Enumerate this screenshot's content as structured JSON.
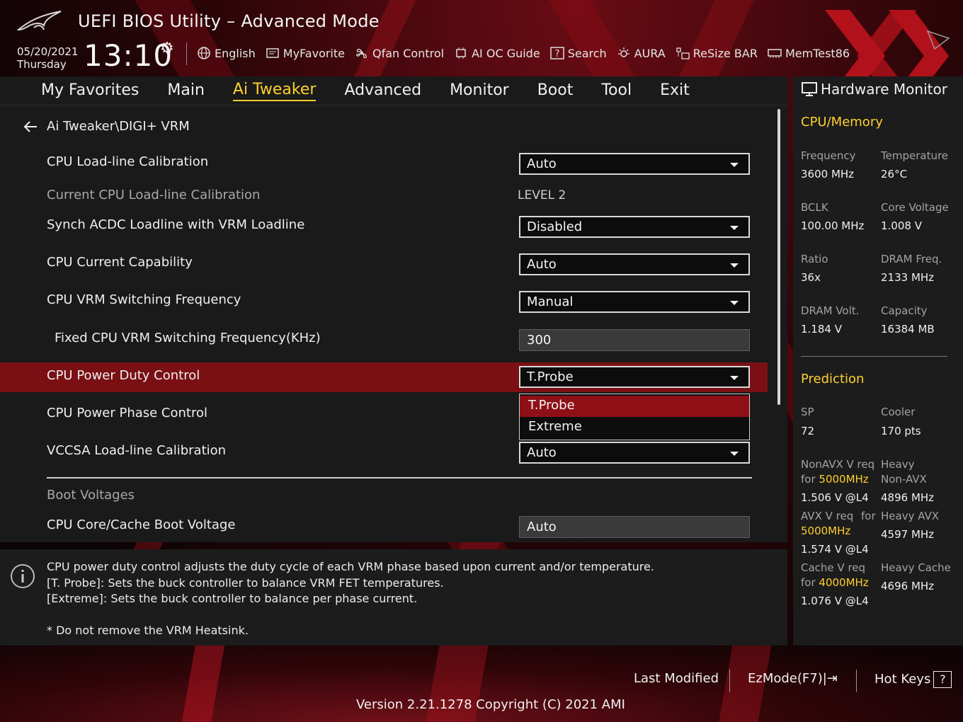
{
  "header": {
    "title": "UEFI BIOS Utility – Advanced Mode",
    "date": "05/20/2021",
    "day": "Thursday",
    "time": "13:10"
  },
  "toolbar": [
    {
      "label": "English",
      "icon": "globe-icon"
    },
    {
      "label": "MyFavorite",
      "icon": "favorite-icon"
    },
    {
      "label": "Qfan Control",
      "icon": "fan-icon"
    },
    {
      "label": "AI OC Guide",
      "icon": "ai-guide-icon"
    },
    {
      "label": "Search",
      "icon": "search-icon"
    },
    {
      "label": "AURA",
      "icon": "aura-icon"
    },
    {
      "label": "ReSize BAR",
      "icon": "resize-bar-icon"
    },
    {
      "label": "MemTest86",
      "icon": "memtest-icon"
    }
  ],
  "menu": {
    "tabs": [
      "My Favorites",
      "Main",
      "Ai Tweaker",
      "Advanced",
      "Monitor",
      "Boot",
      "Tool",
      "Exit"
    ],
    "active": "Ai Tweaker"
  },
  "breadcrumb": "Ai Tweaker\\DIGI+ VRM",
  "settings": {
    "llc": {
      "label": "CPU Load-line Calibration",
      "value": "Auto"
    },
    "current_llc": {
      "label": "Current CPU Load-line Calibration",
      "value": "LEVEL 2"
    },
    "synch": {
      "label": "Synch ACDC Loadline with VRM Loadline",
      "value": "Disabled"
    },
    "current_cap": {
      "label": "CPU Current Capability",
      "value": "Auto"
    },
    "vrm_freq": {
      "label": "CPU VRM Switching Frequency",
      "value": "Manual"
    },
    "fixed_freq": {
      "label": "Fixed CPU VRM Switching Frequency(KHz)",
      "value": "300"
    },
    "duty": {
      "label": "CPU Power Duty Control",
      "value": "T.Probe",
      "options": [
        "T.Probe",
        "Extreme"
      ]
    },
    "phase": {
      "label": "CPU Power Phase Control"
    },
    "vccsa": {
      "label": "VCCSA Load-line Calibration",
      "value": "Auto"
    },
    "boot_section": "Boot Voltages",
    "boot_voltage": {
      "label": "CPU Core/Cache Boot Voltage",
      "value": "Auto"
    }
  },
  "help": {
    "line1": "CPU power duty control adjusts the duty cycle of each VRM phase based upon current and/or temperature.",
    "line2": "[T. Probe]: Sets the buck controller to balance VRM FET temperatures.",
    "line3": "[Extreme]: Sets the buck controller to balance per phase current.",
    "line4": "* Do not remove the VRM Heatsink."
  },
  "hw": {
    "title": "Hardware Monitor",
    "cpu_mem": "CPU/Memory",
    "frequency_k": "Frequency",
    "frequency_v": "3600 MHz",
    "temperature_k": "Temperature",
    "temperature_v": "26°C",
    "bclk_k": "BCLK",
    "bclk_v": "100.00 MHz",
    "corev_k": "Core Voltage",
    "corev_v": "1.008 V",
    "ratio_k": "Ratio",
    "ratio_v": "36x",
    "dramf_k": "DRAM Freq.",
    "dramf_v": "2133 MHz",
    "dramv_k": "DRAM Volt.",
    "dramv_v": "1.184 V",
    "cap_k": "Capacity",
    "cap_v": "16384 MB",
    "prediction": "Prediction",
    "sp_k": "SP",
    "sp_v": "72",
    "cooler_k": "Cooler",
    "cooler_v": "170 pts",
    "nonavx_k1": "NonAVX V req",
    "nonavx_for": "for",
    "nonavx_freq": "5000MHz",
    "nonavx_v": "1.506 V @L4",
    "heavy_k1": "Heavy",
    "heavy_k2": "Non-AVX",
    "heavy_v": "4896 MHz",
    "avx_k1": "AVX V req",
    "avx_for": "for",
    "avx_freq": "5000MHz",
    "avx_v": "1.574 V @L4",
    "heavyavx_k": "Heavy AVX",
    "heavyavx_v": "4597 MHz",
    "cache_k1": "Cache V req",
    "cache_for": "for",
    "cache_freq": "4000MHz",
    "cache_v": "1.076 V @L4",
    "heavycache_k": "Heavy Cache",
    "heavycache_v": "4696 MHz"
  },
  "footer": {
    "last_modified": "Last Modified",
    "ezmode": "EzMode(F7)",
    "hotkeys": "Hot Keys",
    "hotkeys_key": "?",
    "version": "Version 2.21.1278 Copyright (C) 2021 AMI"
  },
  "colors": {
    "accent": "#ffcf2e",
    "selected_row": "#7a1014",
    "highlight": "#8e1016"
  }
}
